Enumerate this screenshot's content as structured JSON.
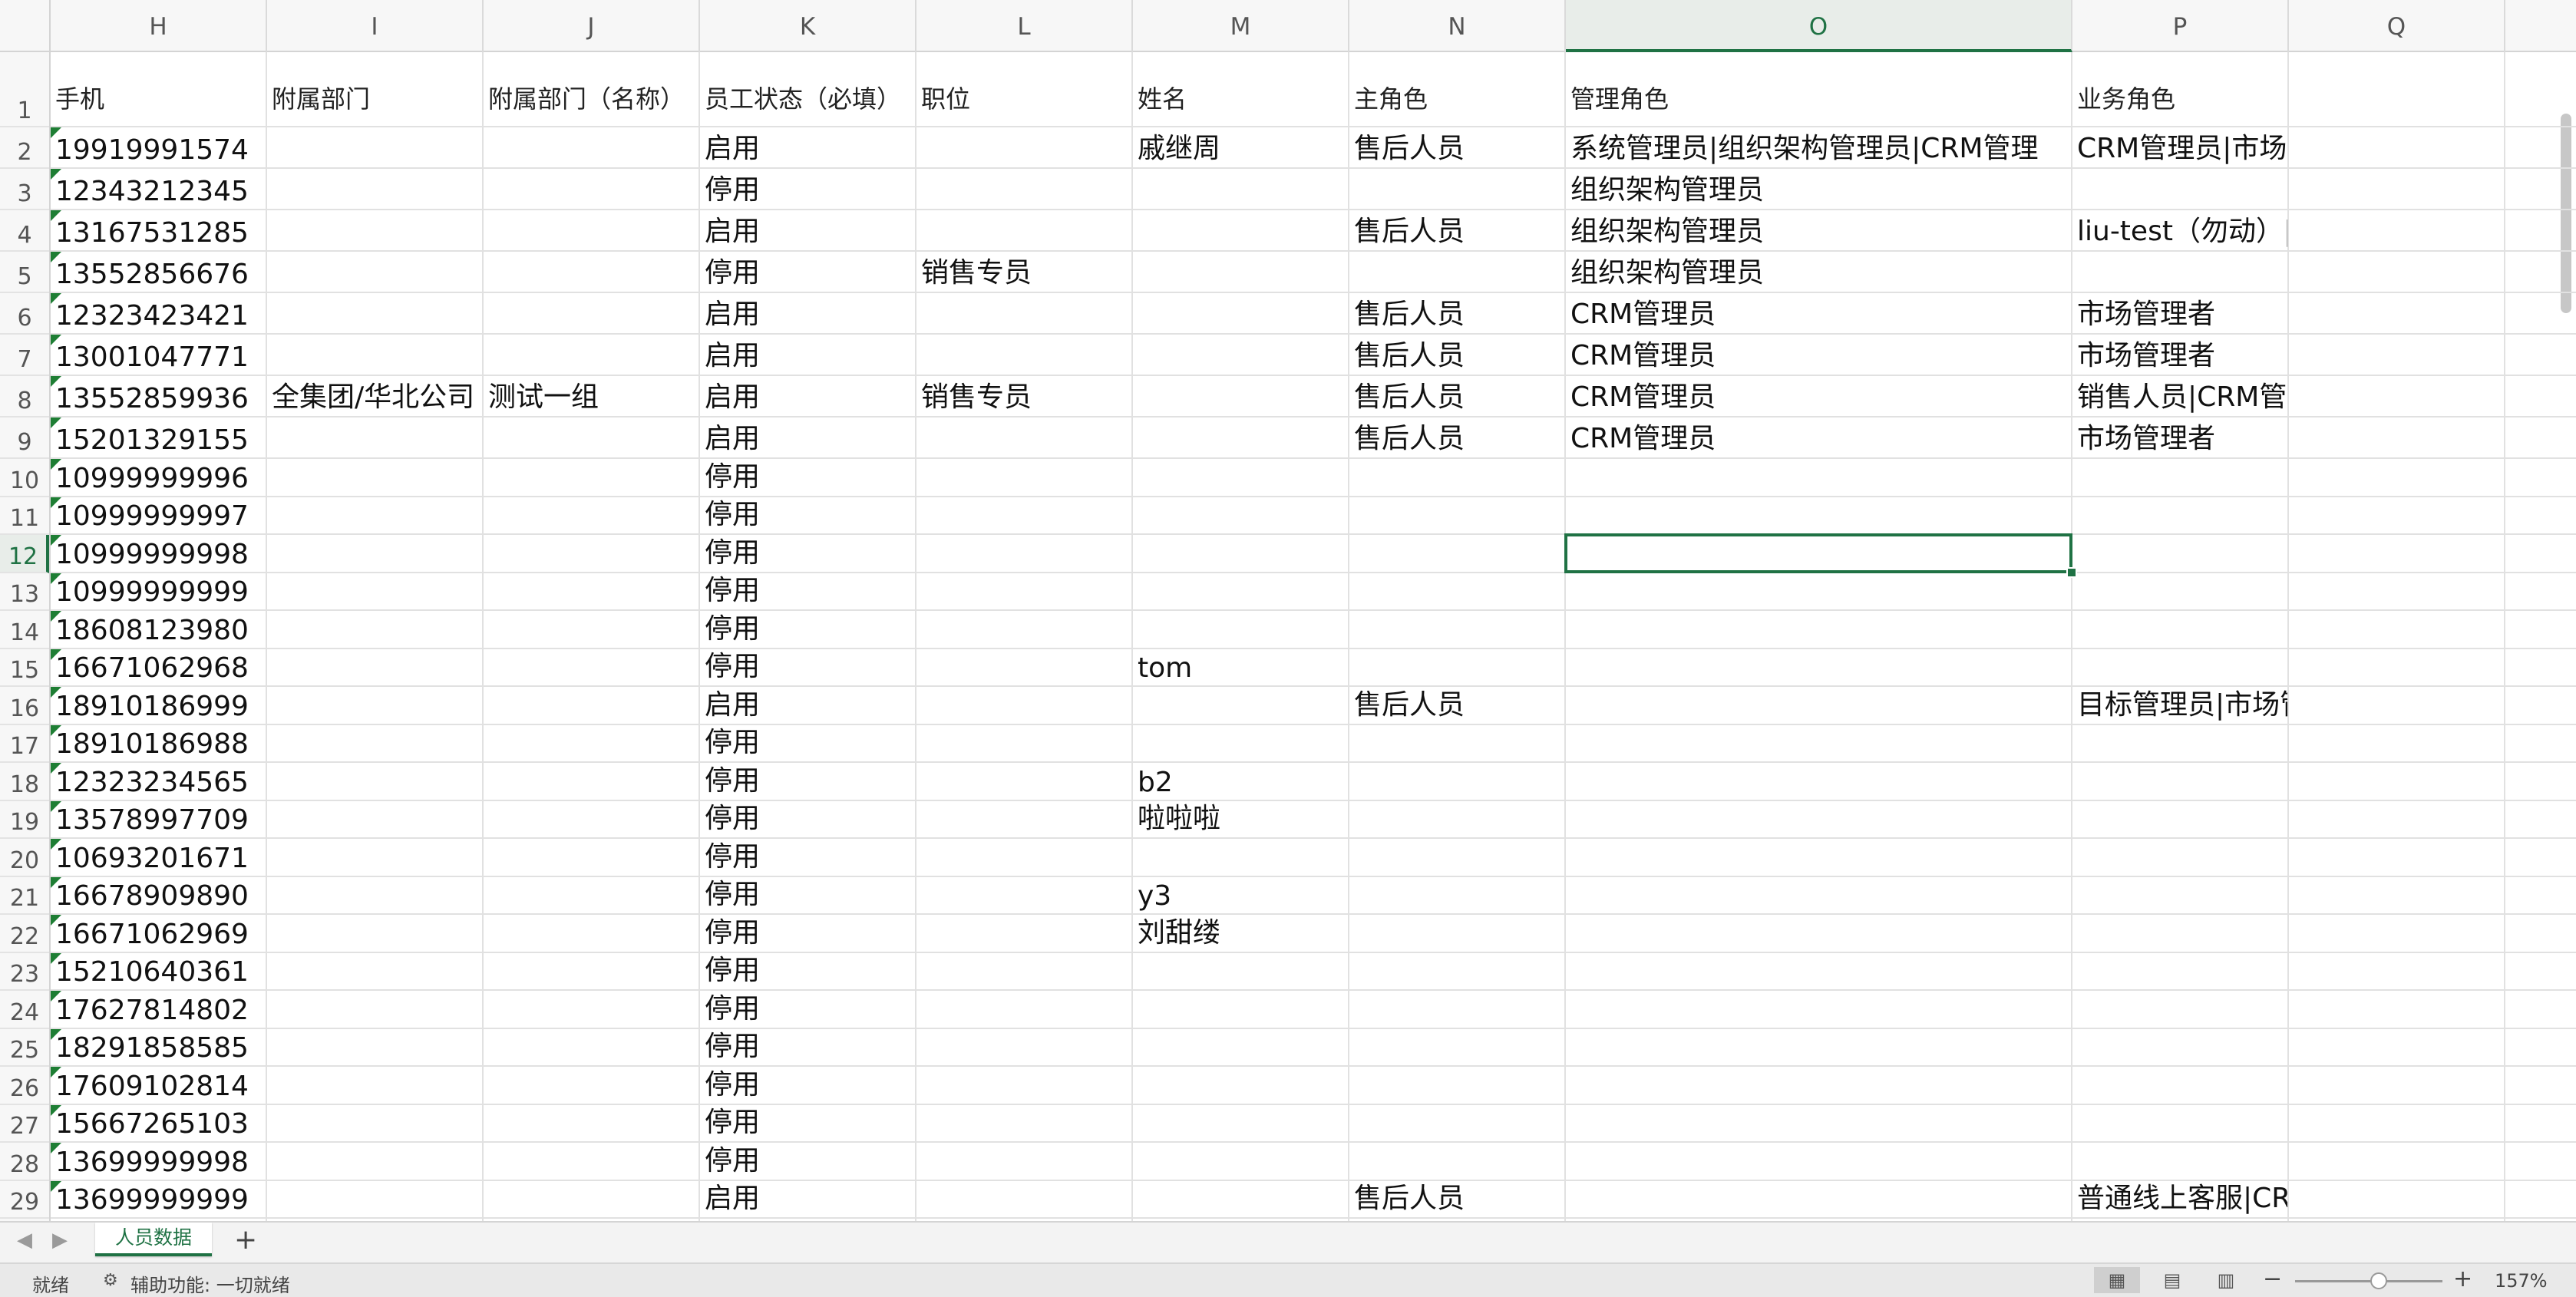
{
  "columns": {
    "letters": [
      "H",
      "I",
      "J",
      "K",
      "L",
      "M",
      "N",
      "O",
      "P",
      "Q"
    ],
    "active": "O"
  },
  "rows": {
    "numbers": [
      "1",
      "2",
      "3",
      "4",
      "5",
      "6",
      "7",
      "8",
      "9",
      "10",
      "11",
      "12",
      "13",
      "14",
      "15",
      "16",
      "17",
      "18",
      "19",
      "20",
      "21",
      "22",
      "23",
      "24",
      "25",
      "26",
      "27",
      "28",
      "29"
    ],
    "active": "12"
  },
  "header_row": [
    "手机",
    "附属部门",
    "附属部门（名称）",
    "员工状态（必填）",
    "职位",
    "姓名",
    "主角色",
    "管理角色",
    "业务角色",
    ""
  ],
  "data_rows": [
    [
      "19919991574",
      "",
      "",
      "启用",
      "",
      "戚继周",
      "售后人员",
      "系统管理员|组织架构管理员|CRM管理",
      "CRM管理员|市场管理者|营销活动主",
      ""
    ],
    [
      "12343212345",
      "",
      "",
      "停用",
      "",
      "",
      "",
      "组织架构管理员",
      "",
      ""
    ],
    [
      "13167531285",
      "",
      "",
      "启用",
      "",
      "",
      "售后人员",
      "组织架构管理员",
      "liu-test（勿动）|CRM观察者|部门主",
      ""
    ],
    [
      "13552856676",
      "",
      "",
      "停用",
      "销售专员",
      "",
      "",
      "组织架构管理员",
      "",
      ""
    ],
    [
      "12323423421",
      "",
      "",
      "启用",
      "",
      "",
      "售后人员",
      "CRM管理员",
      "市场管理者",
      ""
    ],
    [
      "13001047771",
      "",
      "",
      "启用",
      "",
      "",
      "售后人员",
      "CRM管理员",
      "市场管理者",
      ""
    ],
    [
      "13552859936",
      "全集团/华北公司",
      "测试一组",
      "启用",
      "销售专员",
      "",
      "售后人员",
      "CRM管理员",
      "销售人员|CRM管理员|市场管理者|",
      ""
    ],
    [
      "15201329155",
      "",
      "",
      "启用",
      "",
      "",
      "售后人员",
      "CRM管理员",
      "市场管理者",
      ""
    ],
    [
      "10999999996",
      "",
      "",
      "停用",
      "",
      "",
      "",
      "",
      "",
      ""
    ],
    [
      "10999999997",
      "",
      "",
      "停用",
      "",
      "",
      "",
      "",
      "",
      ""
    ],
    [
      "10999999998",
      "",
      "",
      "停用",
      "",
      "",
      "",
      "",
      "",
      ""
    ],
    [
      "10999999999",
      "",
      "",
      "停用",
      "",
      "",
      "",
      "",
      "",
      ""
    ],
    [
      "18608123980",
      "",
      "",
      "停用",
      "",
      "",
      "",
      "",
      "",
      ""
    ],
    [
      "16671062968",
      "",
      "",
      "停用",
      "",
      "tom",
      "",
      "",
      "",
      ""
    ],
    [
      "18910186999",
      "",
      "",
      "启用",
      "",
      "",
      "售后人员",
      "",
      "目标管理员|市场管理者",
      ""
    ],
    [
      "18910186988",
      "",
      "",
      "停用",
      "",
      "",
      "",
      "",
      "",
      ""
    ],
    [
      "12323234565",
      "",
      "",
      "停用",
      "",
      "b2",
      "",
      "",
      "",
      ""
    ],
    [
      "13578997709",
      "",
      "",
      "停用",
      "",
      "啦啦啦",
      "",
      "",
      "",
      ""
    ],
    [
      "10693201671",
      "",
      "",
      "停用",
      "",
      "",
      "",
      "",
      "",
      ""
    ],
    [
      "16678909890",
      "",
      "",
      "停用",
      "",
      "y3",
      "",
      "",
      "",
      ""
    ],
    [
      "16671062969",
      "",
      "",
      "停用",
      "",
      "刘甜缕",
      "",
      "",
      "",
      ""
    ],
    [
      "15210640361",
      "",
      "",
      "停用",
      "",
      "",
      "",
      "",
      "",
      ""
    ],
    [
      "17627814802",
      "",
      "",
      "停用",
      "",
      "",
      "",
      "",
      "",
      ""
    ],
    [
      "18291858585",
      "",
      "",
      "停用",
      "",
      "",
      "",
      "",
      "",
      ""
    ],
    [
      "17609102814",
      "",
      "",
      "停用",
      "",
      "",
      "",
      "",
      "",
      ""
    ],
    [
      "15667265103",
      "",
      "",
      "停用",
      "",
      "",
      "",
      "",
      "",
      ""
    ],
    [
      "13699999998",
      "",
      "",
      "停用",
      "",
      "",
      "",
      "",
      "",
      ""
    ],
    [
      "13699999999",
      "",
      "",
      "启用",
      "",
      "",
      "售后人员",
      "",
      "普通线上客服|CRM管理员|市场管理",
      ""
    ]
  ],
  "sheet": {
    "tab_label": "人员数据",
    "add_icon": "plus-icon",
    "prev_icon": "arrow-left-icon",
    "next_icon": "arrow-right-icon"
  },
  "status": {
    "ready": "就绪",
    "accessibility": "辅助功能: 一切就绪",
    "zoom": "157%",
    "zoom_fraction": 0.57
  },
  "colors": {
    "accent": "#1f7244",
    "flag": "#1e7e34"
  }
}
